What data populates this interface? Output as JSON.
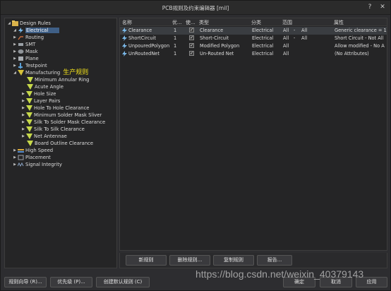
{
  "window": {
    "title": "PCB规则及约束编辑器 [mil]",
    "help_glyph": "?",
    "close_glyph": "✕"
  },
  "tree": {
    "root": "Design Rules",
    "items": [
      {
        "label": "Electrical",
        "selected": true,
        "icon": "electrical-icon"
      },
      {
        "label": "Routing",
        "icon": "routing-icon"
      },
      {
        "label": "SMT",
        "icon": "smt-icon"
      },
      {
        "label": "Mask",
        "icon": "mask-icon"
      },
      {
        "label": "Plane",
        "icon": "plane-icon"
      },
      {
        "label": "Testpoint",
        "icon": "testpoint-icon"
      },
      {
        "label": "Manufacturing",
        "icon": "manufacturing-icon",
        "annotation": "生产规则"
      },
      {
        "label": "Minimum Annular Ring",
        "icon": "rule-icon"
      },
      {
        "label": "Acute Angle",
        "icon": "rule-icon"
      },
      {
        "label": "Hole Size",
        "icon": "rule-icon"
      },
      {
        "label": "Layer Pairs",
        "icon": "rule-icon"
      },
      {
        "label": "Hole To Hole Clearance",
        "icon": "rule-icon"
      },
      {
        "label": "Minimum Solder Mask Sliver",
        "icon": "rule-icon"
      },
      {
        "label": "Silk To Solder Mask Clearance",
        "icon": "rule-icon"
      },
      {
        "label": "Silk To Silk Clearance",
        "icon": "rule-icon"
      },
      {
        "label": "Net Antennae",
        "icon": "rule-icon"
      },
      {
        "label": "Board Outline Clearance",
        "icon": "rule-icon"
      },
      {
        "label": "High Speed",
        "icon": "highspeed-icon"
      },
      {
        "label": "Placement",
        "icon": "placement-icon"
      },
      {
        "label": "Signal Integrity",
        "icon": "signal-icon"
      }
    ]
  },
  "grid": {
    "headers": [
      "名称",
      "优...",
      "使...",
      "类型",
      "分类",
      "范围",
      "属性"
    ],
    "rows": [
      {
        "name": "Clearance",
        "priority": "1",
        "enabled": "✓",
        "type": "Clearance",
        "category": "Electrical",
        "scope1": "All",
        "dash": "-",
        "scope2": "All",
        "attributes": "Generic clearance = 10"
      },
      {
        "name": "ShortCircuit",
        "priority": "1",
        "enabled": "✓",
        "type": "Short-Circuit",
        "category": "Electrical",
        "scope1": "All",
        "dash": "-",
        "scope2": "All",
        "attributes": "Short Circuit - Not All"
      },
      {
        "name": "UnpouredPolygon",
        "priority": "1",
        "enabled": "✓",
        "type": "Modified Polygon",
        "category": "Electrical",
        "scope1": "All",
        "dash": "",
        "scope2": "",
        "attributes": "Allow modified - No  A"
      },
      {
        "name": "UnRoutedNet",
        "priority": "1",
        "enabled": "✓",
        "type": "Un-Routed Net",
        "category": "Electrical",
        "scope1": "All",
        "dash": "",
        "scope2": "",
        "attributes": "(No Attributes)"
      }
    ]
  },
  "grid_buttons": {
    "new_rule": "新规则",
    "delete_rule": "删除规则...",
    "copy_rule": "复制规则",
    "report": "报告..."
  },
  "footer": {
    "rule_wizard": "规则向导 (R)...",
    "priorities": "优先级 (P)...",
    "create_defaults": "创建默认规则 (C)",
    "ok": "确定",
    "cancel": "取消",
    "apply": "应用"
  },
  "watermark": "https://blog.csdn.net/weixin_40379143"
}
